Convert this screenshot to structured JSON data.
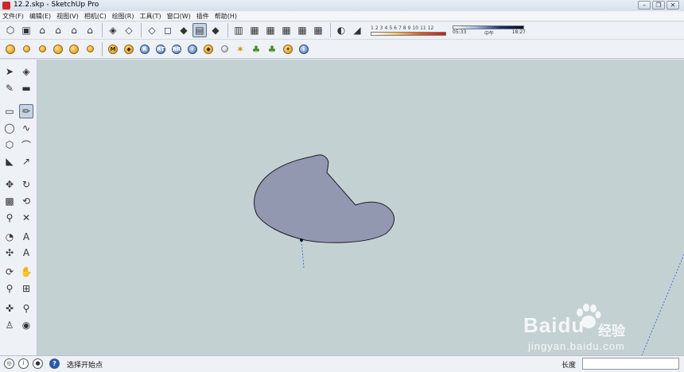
{
  "window": {
    "title": "12.2.skp - SketchUp Pro",
    "minimize_icon": "minimize-icon",
    "maximize_icon": "restore-icon",
    "close_icon": "close-icon"
  },
  "menu": {
    "items": [
      "文件(F)",
      "编辑(E)",
      "视图(V)",
      "相机(C)",
      "绘图(R)",
      "工具(T)",
      "窗口(W)",
      "插件",
      "帮助(H)"
    ]
  },
  "shadow_settings": {
    "month_scale": [
      "1",
      "2",
      "3",
      "4",
      "5",
      "6",
      "7",
      "8",
      "9",
      "10",
      "11",
      "12"
    ],
    "sunrise_time": "05:33",
    "noon_label": "中午",
    "sunset_time": "18:27"
  },
  "status": {
    "message": "选择开始点",
    "measurement_label": "长度",
    "measurement_value": ""
  },
  "watermark": {
    "brand": "Baidu",
    "brand_cn": "经验",
    "url": "jingyan.baidu.com"
  },
  "colors": {
    "viewport_bg": "#c4d1d3",
    "face_fill": "#9398b1",
    "face_edge": "#1a1a24",
    "axis_blue": "#4a6fd0"
  }
}
